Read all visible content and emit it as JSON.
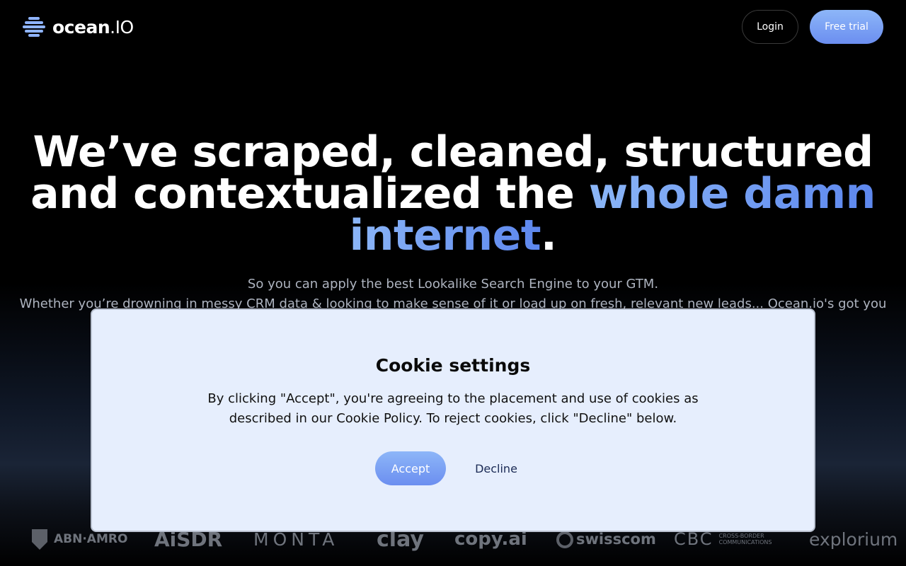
{
  "header": {
    "logo_text": "ocean",
    "logo_suffix": ".IO",
    "login_label": "Login",
    "trial_label": "Free trial"
  },
  "hero": {
    "title_line1": "We’ve scraped, cleaned, structured",
    "title_line2_start": "and contextualized the ",
    "title_accent1": "whole damn",
    "title_accent2": "internet",
    "title_period": ".",
    "subtitle_line1": "So you can apply the best Lookalike Search Engine to your GTM.",
    "subtitle_line2": "Whether you’re drowning in messy CRM data & looking to make sense of it or load up on fresh, relevant new leads... Ocean.io's got you"
  },
  "logos": [
    "ABN·AMRO",
    "AiSDR",
    "MONTA",
    "clay",
    "copy.ai",
    "swisscom",
    "CBC",
    "CROSS-BORDER COMMUNICATIONS",
    "explorium"
  ],
  "cookie": {
    "title": "Cookie settings",
    "text": "By clicking \"Accept\", you're agreeing to the placement and use of cookies as described in our Cookie Policy. To reject cookies, click \"Decline\" below.",
    "accept_label": "Accept",
    "decline_label": "Decline"
  },
  "colors": {
    "accent": "#6b8ef0",
    "accent_light": "#8db6f8",
    "modal_bg": "#e6eefd"
  }
}
